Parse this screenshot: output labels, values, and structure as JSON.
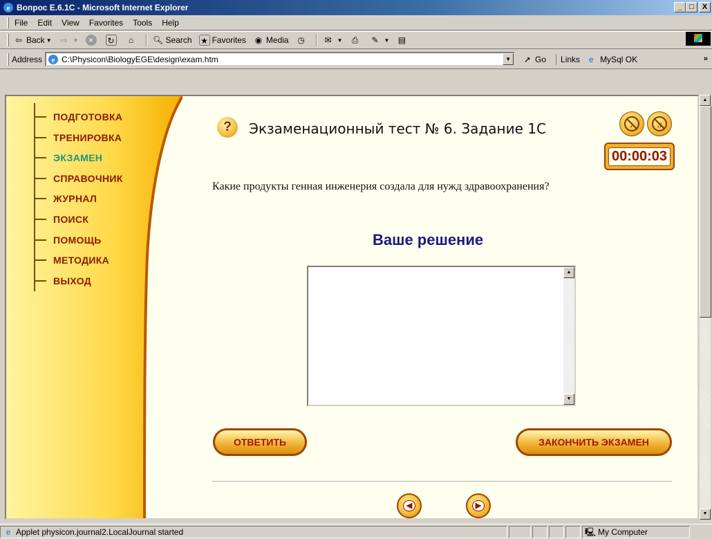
{
  "window": {
    "title": "Вопрос E.6.1C - Microsoft Internet Explorer",
    "min_glyph": "_",
    "max_glyph": "□",
    "close_glyph": "X"
  },
  "menu": [
    "File",
    "Edit",
    "View",
    "Favorites",
    "Tools",
    "Help"
  ],
  "toolbar": {
    "back": "Back",
    "search": "Search",
    "favorites": "Favorites",
    "media": "Media"
  },
  "address": {
    "label": "Address",
    "value": "C:\\Physicon\\BiologyEGE\\design\\exam.htm",
    "go": "Go",
    "links": "Links",
    "mysql": "MySql OK",
    "more": "»"
  },
  "sidebar": {
    "items": [
      {
        "label": "ПОДГОТОВКА",
        "active": false
      },
      {
        "label": "ТРЕНИРОВКА",
        "active": false
      },
      {
        "label": "ЭКЗАМЕН",
        "active": true
      },
      {
        "label": "СПРАВОЧНИК",
        "active": false
      },
      {
        "label": "ЖУРНАЛ",
        "active": false
      },
      {
        "label": "ПОИСК",
        "active": false
      },
      {
        "label": "ПОМОЩЬ",
        "active": false
      },
      {
        "label": "МЕТОДИКА",
        "active": false
      },
      {
        "label": "ВЫХОД",
        "active": false
      }
    ]
  },
  "main": {
    "question_icon": "?",
    "title": "Экзаменационный тест № 6. Задание 1С",
    "timer": "00:00:03",
    "question": "Какие продукты генная инженерия создала для нужд здравоохранения?",
    "solution_heading": "Ваше решение",
    "answer_value": "",
    "answer_button": "ОТВЕТИТЬ",
    "finish_button": "ЗАКОНЧИТЬ ЭКЗАМЕН"
  },
  "status": {
    "text": "Applet physicon.journal2.LocalJournal started",
    "zone": "My Computer"
  },
  "colors": {
    "nav_text": "#8b1a00",
    "nav_active": "#20947b",
    "heading": "#1a1a80",
    "button_face": "#f0b030"
  }
}
